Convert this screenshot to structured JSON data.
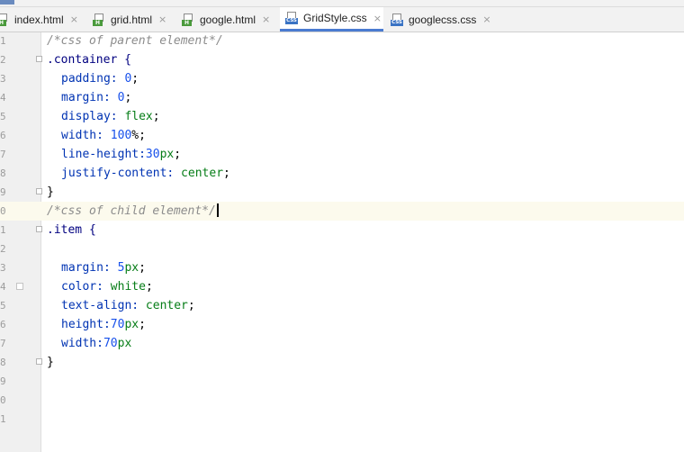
{
  "tabs": [
    {
      "label": "index.html",
      "icon": "html-file-icon",
      "active": false
    },
    {
      "label": "grid.html",
      "icon": "html-file-icon",
      "active": false
    },
    {
      "label": "google.html",
      "icon": "html-file-icon",
      "active": false
    },
    {
      "label": "GridStyle.css",
      "icon": "css-file-icon",
      "active": true
    },
    {
      "label": "googlecss.css",
      "icon": "css-file-icon",
      "active": false
    }
  ],
  "icon_badges": {
    "html": "H",
    "css": "CSS"
  },
  "close_glyph": "×",
  "gutter": {
    "line_numbers": [
      "1",
      "2",
      "3",
      "4",
      "5",
      "6",
      "7",
      "8",
      "9",
      "0",
      "1",
      "2",
      "3",
      "4",
      "5",
      "6",
      "7",
      "8",
      "9",
      "0",
      "1"
    ],
    "current_line_index": 9
  },
  "code": {
    "lines": [
      "/*css of parent element*/",
      ".container {",
      "padding: 0;",
      "margin: 0;",
      "display: flex;",
      "width: 100%;",
      "line-height:30px;",
      "justify-content: center;",
      "}",
      "/*css of child element*/",
      ".item {",
      "",
      "margin: 5px;",
      "color: white;",
      "text-align: center;",
      "height:70px;",
      "width:70px",
      "}"
    ]
  },
  "colors": {
    "comment": "#8c8c8c",
    "selector": "#000080",
    "property": "#0033b3",
    "number": "#1750eb",
    "value": "#067d17",
    "current_line": "#fcfaed",
    "active_tab_underline": "#4a7bd1"
  }
}
